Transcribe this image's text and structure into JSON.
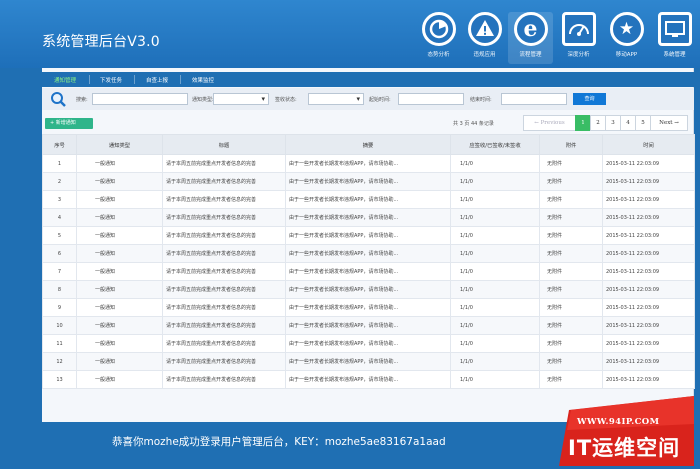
{
  "header": {
    "app_title": "系统管理后台V3.0",
    "nav": [
      {
        "label": "态势分析",
        "icon": "pie-chart-icon"
      },
      {
        "label": "违规应用",
        "icon": "warning-icon"
      },
      {
        "label": "流程管理",
        "icon": "ie-logo-icon",
        "active": true
      },
      {
        "label": "深度分析",
        "icon": "gauge-icon"
      },
      {
        "label": "移动APP",
        "icon": "star-badge-icon"
      },
      {
        "label": "系统管理",
        "icon": "monitor-icon"
      }
    ]
  },
  "subtabs": [
    "通知管理",
    "下发任务",
    "自查上报",
    "效果监控"
  ],
  "filter": {
    "search_label": "搜索:",
    "notice_type_label": "通知类型:",
    "sign_status_label": "签收状态:",
    "start_time_label": "起始时间:",
    "end_time_label": "结束时间:",
    "query_label": "查询"
  },
  "toolbar": {
    "add_label": "+ 新增通知",
    "pager_info": "共 3 页 44 条记录",
    "pages": [
      "← Previous",
      "1",
      "2",
      "3",
      "4",
      "5",
      "Next →"
    ],
    "current_page": "1"
  },
  "table": {
    "headers": [
      "序号",
      "通知类型",
      "标题",
      "摘要",
      "应签收/已签收/未签收",
      "附件",
      "时间"
    ],
    "rows": [
      [
        "1",
        "一般通知",
        "请于本周五前完成重点开发者信息的完善",
        "由于一些开发者长期发布违规APP，请市场协助...",
        "1/1/0",
        "无附件",
        "2015-03-11 22:03:09"
      ],
      [
        "2",
        "一般通知",
        "请于本周五前完成重点开发者信息的完善",
        "由于一些开发者长期发布违规APP，请市场协助...",
        "1/1/0",
        "无附件",
        "2015-03-11 22:03:09"
      ],
      [
        "3",
        "一般通知",
        "请于本周五前完成重点开发者信息的完善",
        "由于一些开发者长期发布违规APP，请市场协助...",
        "1/1/0",
        "无附件",
        "2015-03-11 22:03:09"
      ],
      [
        "4",
        "一般通知",
        "请于本周五前完成重点开发者信息的完善",
        "由于一些开发者长期发布违规APP，请市场协助...",
        "1/1/0",
        "无附件",
        "2015-03-11 22:03:09"
      ],
      [
        "5",
        "一般通知",
        "请于本周五前完成重点开发者信息的完善",
        "由于一些开发者长期发布违规APP，请市场协助...",
        "1/1/0",
        "无附件",
        "2015-03-11 22:03:09"
      ],
      [
        "6",
        "一般通知",
        "请于本周五前完成重点开发者信息的完善",
        "由于一些开发者长期发布违规APP，请市场协助...",
        "1/1/0",
        "无附件",
        "2015-03-11 22:03:09"
      ],
      [
        "7",
        "一般通知",
        "请于本周五前完成重点开发者信息的完善",
        "由于一些开发者长期发布违规APP，请市场协助...",
        "1/1/0",
        "无附件",
        "2015-03-11 22:03:09"
      ],
      [
        "8",
        "一般通知",
        "请于本周五前完成重点开发者信息的完善",
        "由于一些开发者长期发布违规APP，请市场协助...",
        "1/1/0",
        "无附件",
        "2015-03-11 22:03:09"
      ],
      [
        "9",
        "一般通知",
        "请于本周五前完成重点开发者信息的完善",
        "由于一些开发者长期发布违规APP，请市场协助...",
        "1/1/0",
        "无附件",
        "2015-03-11 22:03:09"
      ],
      [
        "10",
        "一般通知",
        "请于本周五前完成重点开发者信息的完善",
        "由于一些开发者长期发布违规APP，请市场协助...",
        "1/1/0",
        "无附件",
        "2015-03-11 22:03:09"
      ],
      [
        "11",
        "一般通知",
        "请于本周五前完成重点开发者信息的完善",
        "由于一些开发者长期发布违规APP，请市场协助...",
        "1/1/0",
        "无附件",
        "2015-03-11 22:03:09"
      ],
      [
        "12",
        "一般通知",
        "请于本周五前完成重点开发者信息的完善",
        "由于一些开发者长期发布违规APP，请市场协助...",
        "1/1/0",
        "无附件",
        "2015-03-11 22:03:09"
      ],
      [
        "13",
        "一般通知",
        "请于本周五前完成重点开发者信息的完善",
        "由于一些开发者长期发布违规APP，请市场协助...",
        "1/1/0",
        "无附件",
        "2015-03-11 22:03:09"
      ]
    ]
  },
  "footer": {
    "welcome": "恭喜你mozhe成功登录用户管理后台，KEY：mozhe5ae83167a1aad"
  },
  "watermark": {
    "url": "WWW.94IP.COM",
    "name": "IT运维空间"
  },
  "colors": {
    "header_blue": "#1f6fb3",
    "accent_green": "#39bd65",
    "query_blue": "#1178d6",
    "watermark_red": "#d9231c"
  }
}
